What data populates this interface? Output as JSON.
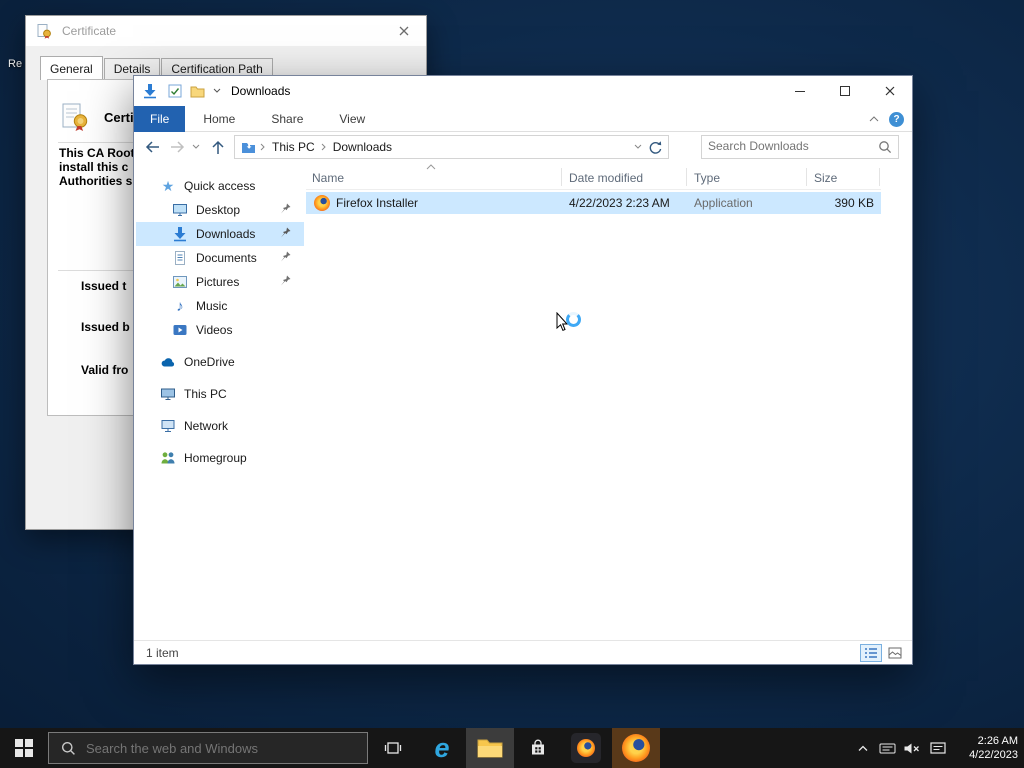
{
  "desktop": {
    "partial_icon_label": "Re"
  },
  "colors": {
    "accent_blue": "#2262b0",
    "selection_blue": "#cce8ff",
    "taskbar_bg": "#161616",
    "firefox_orange": "#f3641f"
  },
  "glyphs": {
    "help": "?",
    "music_note": "♪",
    "quick_access_star": "★",
    "edge_logo": "e"
  },
  "certificate_dialog": {
    "title": "Certificate",
    "tabs": [
      {
        "label": "General"
      },
      {
        "label": "Details"
      },
      {
        "label": "Certification Path"
      }
    ],
    "heading": "Certif",
    "info_lines": [
      {
        "text": "This CA Root"
      },
      {
        "text": "install this c"
      },
      {
        "text": "Authorities s"
      }
    ],
    "field_labels": [
      {
        "text": "Issued t"
      },
      {
        "text": "Issued b"
      },
      {
        "text": "Valid fro"
      }
    ]
  },
  "explorer": {
    "title": "Downloads",
    "ribbon_tabs": [
      {
        "label": "File"
      },
      {
        "label": "Home"
      },
      {
        "label": "Share"
      },
      {
        "label": "View"
      }
    ],
    "address": {
      "root": "This PC",
      "current": "Downloads"
    },
    "search_placeholder": "Search Downloads",
    "sidebar": [
      {
        "label": "Quick access"
      },
      {
        "label": "Desktop"
      },
      {
        "label": "Downloads"
      },
      {
        "label": "Documents"
      },
      {
        "label": "Pictures"
      },
      {
        "label": "Music"
      },
      {
        "label": "Videos"
      },
      {
        "label": "OneDrive"
      },
      {
        "label": "This PC"
      },
      {
        "label": "Network"
      },
      {
        "label": "Homegroup"
      }
    ],
    "columns": [
      {
        "label": "Name"
      },
      {
        "label": "Date modified"
      },
      {
        "label": "Type"
      },
      {
        "label": "Size"
      }
    ],
    "files": [
      {
        "name": "Firefox Installer",
        "date_modified": "4/22/2023 2:23 AM",
        "type": "Application",
        "size": "390 KB"
      }
    ],
    "status_text": "1 item"
  },
  "taskbar": {
    "search_placeholder": "Search the web and Windows",
    "clock": {
      "time": "2:26 AM",
      "date": "4/22/2023"
    }
  }
}
